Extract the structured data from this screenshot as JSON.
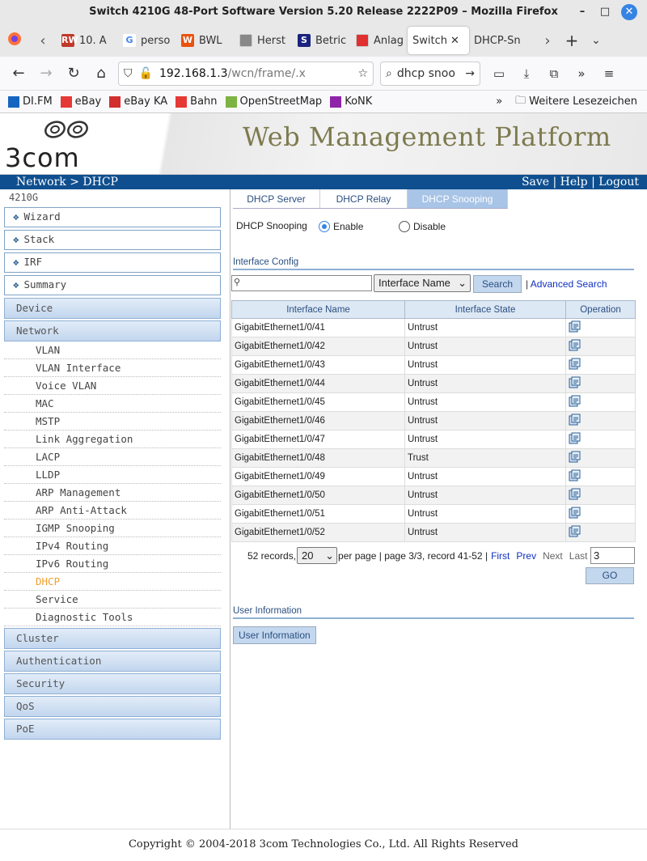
{
  "window": {
    "title": "Switch 4210G 48-Port Software Version 5.20 Release 2222P09 – Mozilla Firefox"
  },
  "tabs": [
    {
      "label": "10. A",
      "fav": "RW",
      "color": "#c0392b"
    },
    {
      "label": "perso",
      "fav": "G",
      "color": "#ffffff"
    },
    {
      "label": "BWL",
      "fav": "W",
      "color": "#e8530e"
    },
    {
      "label": "Herst",
      "fav": "",
      "color": "#888888"
    },
    {
      "label": "Betric",
      "fav": "S",
      "color": "#1a237e"
    },
    {
      "label": "Anlag",
      "fav": "",
      "color": "#e03030"
    },
    {
      "label": "Switch",
      "fav": "",
      "color": "#ffffff"
    },
    {
      "label": "DHCP-Sn",
      "fav": "",
      "color": "#ffffff"
    }
  ],
  "nav": {
    "url_host": "192.168.1.3",
    "url_path": "/wcn/frame/.x",
    "search_text": "dhcp snoo"
  },
  "bookmarks": [
    {
      "label": "DI.FM",
      "color": "#1565c0"
    },
    {
      "label": "eBay",
      "color": "#e53935"
    },
    {
      "label": "eBay KA",
      "color": "#d32f2f"
    },
    {
      "label": "Bahn",
      "color": "#e53935"
    },
    {
      "label": "OpenStreetMap",
      "color": "#7cb342"
    },
    {
      "label": "KoNK",
      "color": "#8e24aa"
    }
  ],
  "bookmarks_other": "Weitere Lesezeichen",
  "header": {
    "logo_text": "3com",
    "platform_title": "Web Management Platform"
  },
  "bluebar": {
    "breadcrumb": "Network > DHCP",
    "links": "Save | Help | Logout"
  },
  "sidebar": {
    "model": "4210G",
    "top_items": [
      "Wizard",
      "Stack",
      "IRF",
      "Summary"
    ],
    "device": "Device",
    "network": "Network",
    "network_items": [
      "VLAN",
      "VLAN Interface",
      "Voice VLAN",
      "MAC",
      "MSTP",
      "Link Aggregation",
      "LACP",
      "LLDP",
      "ARP Management",
      "ARP Anti-Attack",
      "IGMP Snooping",
      "IPv4 Routing",
      "IPv6 Routing",
      "DHCP",
      "Service",
      "Diagnostic Tools"
    ],
    "active_item": "DHCP",
    "bottom_items": [
      "Cluster",
      "Authentication",
      "Security",
      "QoS",
      "PoE"
    ]
  },
  "content_tabs": [
    "DHCP Server",
    "DHCP Relay",
    "DHCP Snooping"
  ],
  "snooping": {
    "label": "DHCP Snooping",
    "enable": "Enable",
    "disable": "Disable",
    "selected": "Enable"
  },
  "interface_config": {
    "title": "Interface Config",
    "search_value": "",
    "field_select": "Interface Name",
    "search_button": "Search",
    "advanced": "Advanced Search",
    "columns": [
      "Interface Name",
      "Interface State",
      "Operation"
    ],
    "rows": [
      {
        "name": "GigabitEthernet1/0/41",
        "state": "Untrust"
      },
      {
        "name": "GigabitEthernet1/0/42",
        "state": "Untrust"
      },
      {
        "name": "GigabitEthernet1/0/43",
        "state": "Untrust"
      },
      {
        "name": "GigabitEthernet1/0/44",
        "state": "Untrust"
      },
      {
        "name": "GigabitEthernet1/0/45",
        "state": "Untrust"
      },
      {
        "name": "GigabitEthernet1/0/46",
        "state": "Untrust"
      },
      {
        "name": "GigabitEthernet1/0/47",
        "state": "Untrust"
      },
      {
        "name": "GigabitEthernet1/0/48",
        "state": "Trust"
      },
      {
        "name": "GigabitEthernet1/0/49",
        "state": "Untrust"
      },
      {
        "name": "GigabitEthernet1/0/50",
        "state": "Untrust"
      },
      {
        "name": "GigabitEthernet1/0/51",
        "state": "Untrust"
      },
      {
        "name": "GigabitEthernet1/0/52",
        "state": "Untrust"
      }
    ]
  },
  "pager": {
    "records": "52 records,",
    "per_page_value": "20",
    "per_page_text": "per page | page 3/3, record 41-52 |",
    "first": "First",
    "prev": "Prev",
    "next": "Next",
    "last": "Last",
    "page_input": "3",
    "go": "GO"
  },
  "user_info": {
    "title": "User Information",
    "button": "User Information"
  },
  "footer": "Copyright © 2004-2018 3com Technologies Co., Ltd. All Rights Reserved"
}
